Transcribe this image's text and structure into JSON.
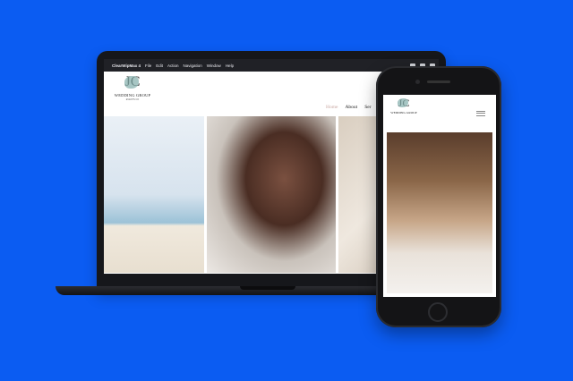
{
  "menubar": {
    "app_name": "ClearWipMax 4",
    "items": [
      "File",
      "Edit",
      "Action",
      "Navigation",
      "Window",
      "Help"
    ]
  },
  "site": {
    "logo_monogram": "JC",
    "logo_name": "WEDDING GROUP",
    "logo_sub": "EVENTS CO",
    "nav": [
      "Home",
      "About",
      "Ser"
    ]
  },
  "phone": {
    "logo_monogram": "JC",
    "logo_name": "WEDDING GROUP"
  },
  "colors": {
    "background": "#0b5cf2",
    "accent_nav": "#c9a8a3",
    "logo_leaf": "#8ab3b0"
  }
}
